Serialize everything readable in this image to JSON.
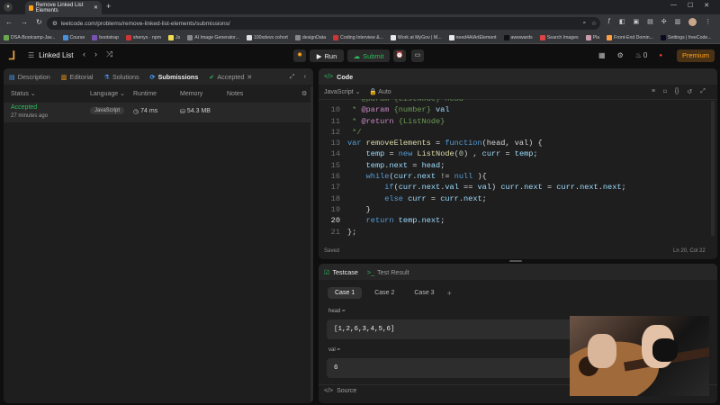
{
  "browser": {
    "tab_title": "Remove Linked List Elements",
    "url": "leetcode.com/problems/remove-linked-list-elements/submissions/",
    "bookmarks": [
      "DSA-Bootcamp-Jav...",
      "Course",
      "bootstrap",
      "shenys · npm",
      "Js",
      "AI Image Generator...",
      "100xdevs cohort",
      "designData",
      "Coding Interview &...",
      "Work at MyGov | M...",
      "need4AIArtElement",
      "awwwards",
      "Search Images",
      "Pla",
      "Front-End Domin...",
      "Settings | freeCode..."
    ]
  },
  "nav": {
    "problem_list": "Linked List",
    "run": "Run",
    "submit": "Submit",
    "streak": "0",
    "premium": "Premium"
  },
  "left": {
    "tabs": [
      "Description",
      "Editorial",
      "Solutions",
      "Submissions",
      "Accepted"
    ],
    "headers": [
      "Status",
      "Language",
      "Runtime",
      "Memory",
      "Notes"
    ],
    "row": {
      "status": "Accepted",
      "time": "27 minutes ago",
      "language": "JavaScript",
      "runtime": "74 ms",
      "memory": "54.3 MB"
    }
  },
  "code": {
    "title": "Code",
    "language": "JavaScript",
    "format": "Auto",
    "saved": "Saved",
    "cursor": "Ln 20, Col 22",
    "lines": [
      {
        "n": "",
        "parts": [
          [
            "cm",
            " * @param {ListNode} head"
          ]
        ]
      },
      {
        "n": "10",
        "parts": [
          [
            "cm",
            " * "
          ],
          [
            "at",
            "@param"
          ],
          [
            "cm",
            " {number} "
          ],
          [
            "vr",
            "val"
          ]
        ]
      },
      {
        "n": "11",
        "parts": [
          [
            "cm",
            " * "
          ],
          [
            "at",
            "@return"
          ],
          [
            "cm",
            " {ListNode}"
          ]
        ]
      },
      {
        "n": "12",
        "parts": [
          [
            "cm",
            " */"
          ]
        ]
      },
      {
        "n": "13",
        "parts": [
          [
            "kw",
            "var "
          ],
          [
            "fn",
            "removeElements"
          ],
          [
            "tx",
            " = "
          ],
          [
            "kw",
            "function"
          ],
          [
            "tx",
            "(head, val) {"
          ]
        ]
      },
      {
        "n": "14",
        "parts": [
          [
            "tx",
            "    "
          ],
          [
            "vr",
            "temp"
          ],
          [
            "tx",
            " = "
          ],
          [
            "kw",
            "new "
          ],
          [
            "fn",
            "ListNode"
          ],
          [
            "tx",
            "("
          ],
          [
            "nm",
            "0"
          ],
          [
            "tx",
            ") , "
          ],
          [
            "vr",
            "curr"
          ],
          [
            "tx",
            " = "
          ],
          [
            "vr",
            "temp"
          ],
          [
            "tx",
            ";"
          ]
        ]
      },
      {
        "n": "15",
        "parts": [
          [
            "tx",
            "    "
          ],
          [
            "vr",
            "temp"
          ],
          [
            "tx",
            "."
          ],
          [
            "vr",
            "next"
          ],
          [
            "tx",
            " = "
          ],
          [
            "vr",
            "head"
          ],
          [
            "tx",
            ";"
          ]
        ]
      },
      {
        "n": "16",
        "parts": [
          [
            "tx",
            "    "
          ],
          [
            "kw",
            "while"
          ],
          [
            "tx",
            "("
          ],
          [
            "vr",
            "curr"
          ],
          [
            "tx",
            "."
          ],
          [
            "vr",
            "next"
          ],
          [
            "tx",
            " != "
          ],
          [
            "kw",
            "null"
          ],
          [
            "tx",
            " ){"
          ]
        ]
      },
      {
        "n": "17",
        "parts": [
          [
            "tx",
            "        "
          ],
          [
            "kw",
            "if"
          ],
          [
            "tx",
            "("
          ],
          [
            "vr",
            "curr"
          ],
          [
            "tx",
            "."
          ],
          [
            "vr",
            "next"
          ],
          [
            "tx",
            "."
          ],
          [
            "vr",
            "val"
          ],
          [
            "tx",
            " == "
          ],
          [
            "vr",
            "val"
          ],
          [
            "tx",
            ") "
          ],
          [
            "vr",
            "curr"
          ],
          [
            "tx",
            "."
          ],
          [
            "vr",
            "next"
          ],
          [
            "tx",
            " = "
          ],
          [
            "vr",
            "curr"
          ],
          [
            "tx",
            "."
          ],
          [
            "vr",
            "next"
          ],
          [
            "tx",
            "."
          ],
          [
            "vr",
            "next"
          ],
          [
            "tx",
            ";"
          ]
        ]
      },
      {
        "n": "18",
        "parts": [
          [
            "tx",
            "        "
          ],
          [
            "kw",
            "else "
          ],
          [
            "vr",
            "curr"
          ],
          [
            "tx",
            " = "
          ],
          [
            "vr",
            "curr"
          ],
          [
            "tx",
            "."
          ],
          [
            "vr",
            "next"
          ],
          [
            "tx",
            ";"
          ]
        ]
      },
      {
        "n": "19",
        "parts": [
          [
            "tx",
            "    }"
          ]
        ]
      },
      {
        "n": "20",
        "parts": [
          [
            "tx",
            "    "
          ],
          [
            "kw",
            "return "
          ],
          [
            "vr",
            "temp"
          ],
          [
            "tx",
            "."
          ],
          [
            "vr",
            "next"
          ],
          [
            "tx",
            ";"
          ]
        ]
      },
      {
        "n": "21",
        "parts": [
          [
            "tx",
            "};"
          ]
        ]
      }
    ]
  },
  "tests": {
    "tabs": [
      "Testcase",
      "Test Result"
    ],
    "cases": [
      "Case 1",
      "Case 2",
      "Case 3"
    ],
    "head_label": "head =",
    "head_value": "[1,2,6,3,4,5,6]",
    "val_label": "val =",
    "val_value": "6",
    "source": "Source"
  },
  "colors": {
    "accent": "#ffa116",
    "green": "#2cbb5d",
    "blue": "#4a9eff"
  }
}
